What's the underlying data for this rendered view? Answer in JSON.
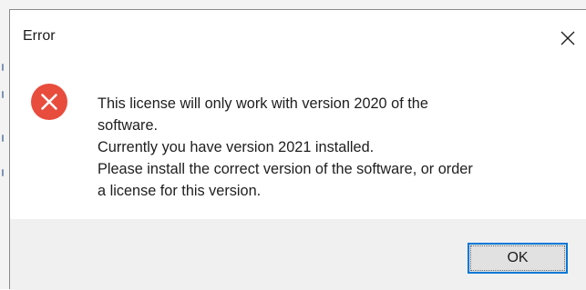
{
  "dialog": {
    "title": "Error",
    "close_icon": "close-icon",
    "icon": "error-circle-x-icon",
    "message_lines": [
      "This license will only work with version 2020 of the",
      "software.",
      "Currently you have version 2021 installed.",
      "Please install the correct version of the software, or order",
      "a license for this version."
    ],
    "ok_label": "OK"
  },
  "colors": {
    "error_red": "#e84c3d",
    "button_focus": "#0078d7",
    "footer_bg": "#f0f0f0"
  }
}
